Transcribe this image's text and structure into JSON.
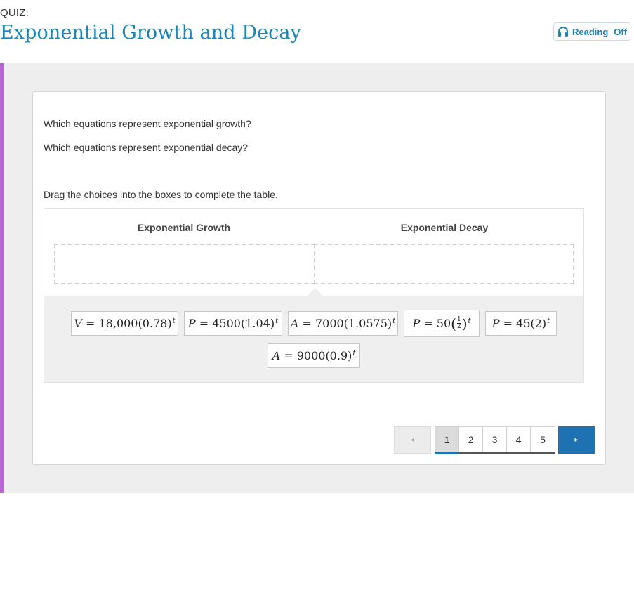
{
  "header": {
    "kicker": "QUIZ:",
    "title": "Exponential Growth and Decay",
    "reading": {
      "label": "Reading",
      "state": "Off"
    }
  },
  "question": {
    "prompt1": "Which equations represent exponential growth?",
    "prompt2": "Which equations represent exponential decay?",
    "instruction": "Drag the choices into the boxes to complete the table."
  },
  "table": {
    "col_growth": "Exponential Growth",
    "col_decay": "Exponential Decay"
  },
  "choices": [
    {
      "var": "V",
      "base": "18,000(0.78)",
      "exp": "t"
    },
    {
      "var": "P",
      "base": "4500(1.04)",
      "exp": "t"
    },
    {
      "var": "A",
      "base": "7000(1.0575)",
      "exp": "t"
    },
    {
      "var": "P",
      "coef": "50",
      "num": "1",
      "den": "2",
      "exp": "t"
    },
    {
      "var": "P",
      "base": "45(2)",
      "exp": "t"
    },
    {
      "var": "A",
      "base": "9000(0.9)",
      "exp": "t"
    }
  ],
  "pagination": {
    "prev": "◂",
    "next": "▸",
    "pages": [
      "1",
      "2",
      "3",
      "4",
      "5"
    ],
    "current": "1"
  },
  "colors": {
    "title": "#1a86b8",
    "accent_bar": "#b866d4",
    "next_button": "#1e72b2"
  }
}
